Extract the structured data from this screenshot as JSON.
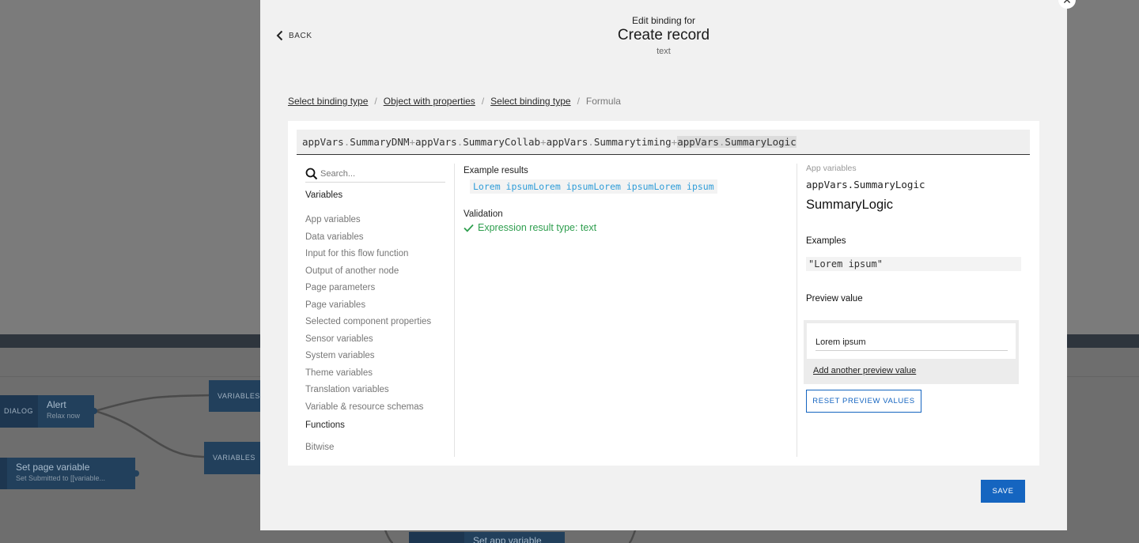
{
  "background": {
    "nodes": {
      "dialog_label": "DIALOG",
      "alert_title": "Alert",
      "alert_sub": "Relax now",
      "variables_1": "VARIABLES",
      "variables_2": "VARIABLES",
      "set_page_title": "Set page variable",
      "set_page_sub": "Set Submitted to [[variable...",
      "set_app_title": "Set app variable"
    }
  },
  "modal": {
    "close_icon": "close-icon",
    "back_label": "BACK",
    "header": {
      "pre": "Edit binding for",
      "title": "Create record",
      "type": "text"
    },
    "breadcrumbs": {
      "item1": "Select binding type",
      "item2": "Object with properties",
      "item3": "Select binding type",
      "current": "Formula",
      "sep": "/"
    },
    "formula": {
      "t1": "appVars",
      "d1": ".",
      "t2": "SummaryDNM",
      "p1": "+",
      "t3": "appVars",
      "d2": ".",
      "t4": "SummaryCollab",
      "p2": "+",
      "t5": "appVars",
      "d3": ".",
      "t6": "Summarytiming",
      "p3": "+",
      "t7": "appVars",
      "d4": ".",
      "t8": "SummaryLogic"
    },
    "left": {
      "search_placeholder": "Search...",
      "variables_heading": "Variables",
      "variables": [
        "App variables",
        "Data variables",
        "Input for this flow function",
        "Output of another node",
        "Page parameters",
        "Page variables",
        "Selected component properties",
        "Sensor variables",
        "System variables",
        "Theme variables",
        "Translation variables",
        "Variable & resource schemas"
      ],
      "functions_heading": "Functions",
      "functions": [
        "Bitwise"
      ]
    },
    "middle": {
      "example_heading": "Example results",
      "example_value": "Lorem ipsumLorem ipsumLorem ipsumLorem ipsum",
      "validation_heading": "Validation",
      "validation_text": "Expression result type: text"
    },
    "right": {
      "category": "App variables",
      "path": "appVars.SummaryLogic",
      "name": "SummaryLogic",
      "examples_heading": "Examples",
      "example_value": "\"Lorem ipsum\"",
      "preview_heading": "Preview value",
      "preview_input_value": "Lorem ipsum",
      "add_preview_label": "Add another preview value",
      "reset_label": "RESET PREVIEW VALUES"
    },
    "save_label": "SAVE"
  },
  "colors": {
    "accent": "#1565c0",
    "success": "#2e9e4e",
    "example_text": "#2f9dd8"
  }
}
